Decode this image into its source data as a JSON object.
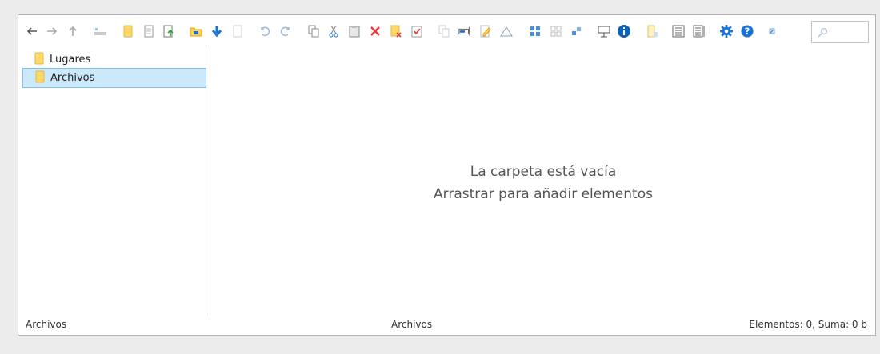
{
  "toolbar": {
    "buttons": [
      {
        "name": "back-icon"
      },
      {
        "name": "forward-icon"
      },
      {
        "name": "up-icon"
      },
      {
        "name": "drive-icon"
      },
      {
        "name": "new-folder-icon"
      },
      {
        "name": "new-file-icon"
      },
      {
        "name": "upload-file-icon"
      },
      {
        "name": "open-folder-icon"
      },
      {
        "name": "download-icon"
      },
      {
        "name": "blank-page-icon"
      },
      {
        "name": "undo-icon"
      },
      {
        "name": "redo-icon"
      },
      {
        "name": "copy-icon"
      },
      {
        "name": "cut-icon"
      },
      {
        "name": "paste-icon"
      },
      {
        "name": "delete-icon"
      },
      {
        "name": "delete-folder-icon"
      },
      {
        "name": "select-all-icon"
      },
      {
        "name": "duplicate-icon"
      },
      {
        "name": "rename-icon"
      },
      {
        "name": "edit-icon"
      },
      {
        "name": "resize-icon"
      },
      {
        "name": "view-large-icon"
      },
      {
        "name": "view-medium-icon"
      },
      {
        "name": "view-small-icon"
      },
      {
        "name": "preview-icon"
      },
      {
        "name": "info-icon"
      },
      {
        "name": "sort-icon"
      },
      {
        "name": "list-view-icon"
      },
      {
        "name": "details-view-icon"
      },
      {
        "name": "settings-icon"
      },
      {
        "name": "help-icon"
      },
      {
        "name": "fullscreen-icon"
      }
    ],
    "search_placeholder": ""
  },
  "tree": {
    "items": [
      {
        "label": "Lugares",
        "selected": false
      },
      {
        "label": "Archivos",
        "selected": true
      }
    ]
  },
  "content": {
    "empty_line1": "La carpeta está vacía",
    "empty_line2": "Arrastrar para añadir elementos"
  },
  "status": {
    "left": "Archivos",
    "center": "Archivos",
    "right": "Elementos: 0, Suma: 0 b"
  },
  "colors": {
    "accent": "#1a73d8",
    "selection_bg": "#cce8fb",
    "selection_border": "#7ec3ef",
    "folder": "#ffd966",
    "delete": "#e53935"
  }
}
